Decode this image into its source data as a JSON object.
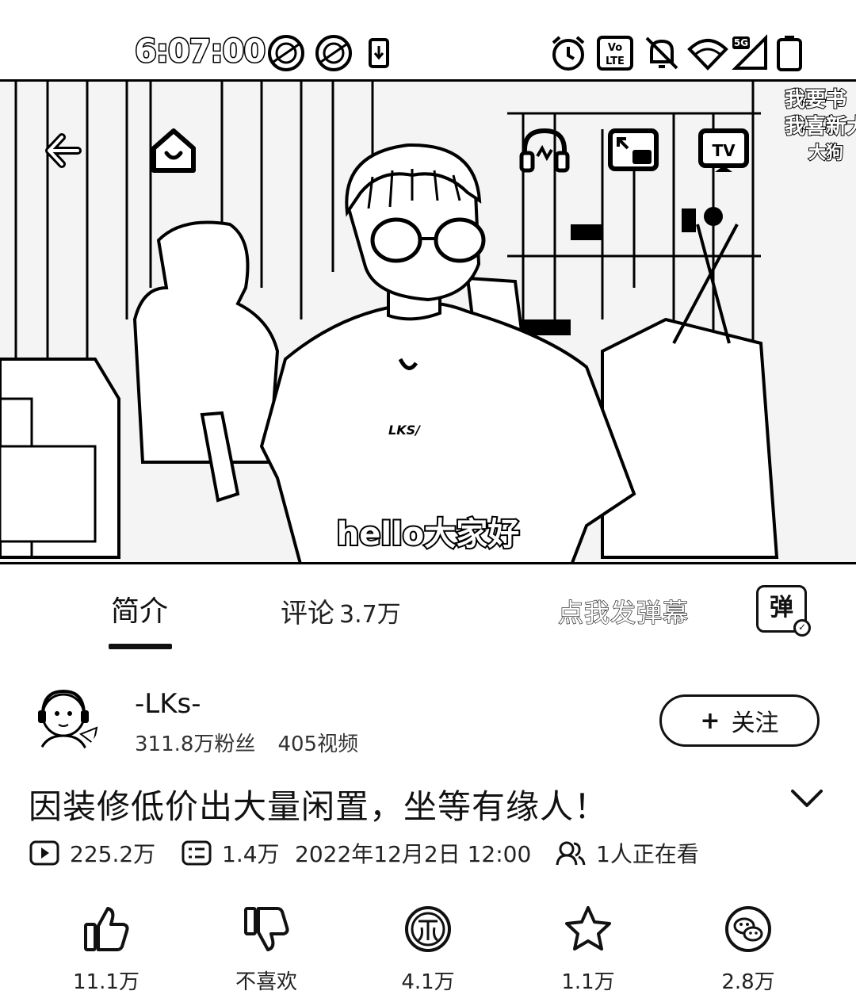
{
  "status_bar": {
    "time": "6:07:00",
    "icons": [
      "app-icon-1",
      "app-icon-2",
      "download-icon",
      "alarm-icon",
      "volte-icon",
      "mute-icon",
      "wifi-icon",
      "5g-signal-icon",
      "battery-icon"
    ],
    "volte_top": "Vo",
    "volte_bottom": "LTE",
    "signal_label": "5G"
  },
  "player": {
    "controls": [
      "back-icon",
      "home-icon",
      "headphones-icon",
      "pip-icon",
      "cast-tv-icon"
    ],
    "danmaku_lines": [
      "我要书",
      "我喜新大",
      "大狗"
    ],
    "subtitle": "hello大家好",
    "shirt_text": "LKS/"
  },
  "tabs": {
    "intro": "简介",
    "comments_label": "评论",
    "comments_count": "3.7万",
    "danmaku_placeholder": "点我发弹幕",
    "danmaku_button": "弹"
  },
  "uploader": {
    "name": "-LKs-",
    "followers": "311.8万粉丝",
    "videos": "405视频",
    "follow_label": "关注",
    "follow_prefix": "+"
  },
  "video": {
    "title": "因装修低价出大量闲置，坐等有缘人！",
    "plays": "225.2万",
    "danmaku_count": "1.4万",
    "date": "2022年12月2日 12:00",
    "watching": "1人正在看"
  },
  "actions": [
    {
      "icon": "like-icon",
      "label": "11.1万"
    },
    {
      "icon": "dislike-icon",
      "label": "不喜欢"
    },
    {
      "icon": "coin-icon",
      "label": "4.1万"
    },
    {
      "icon": "star-icon",
      "label": "1.1万"
    },
    {
      "icon": "share-wechat-icon",
      "label": "2.8万"
    }
  ]
}
